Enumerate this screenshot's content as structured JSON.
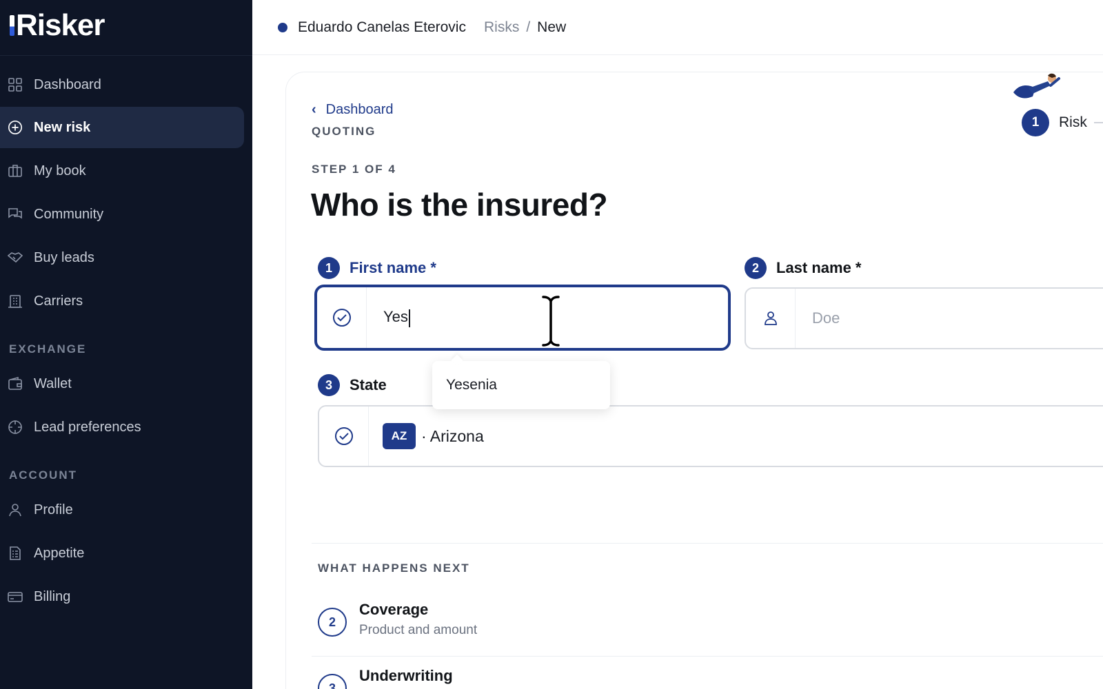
{
  "app": {
    "logo": "Risker"
  },
  "sidebar": {
    "items": [
      {
        "label": "Dashboard",
        "icon": "grid-icon"
      },
      {
        "label": "New risk",
        "icon": "plus-circle-icon",
        "active": true
      },
      {
        "label": "My book",
        "icon": "briefcase-icon"
      },
      {
        "label": "Community",
        "icon": "chat-icon"
      },
      {
        "label": "Buy leads",
        "icon": "handshake-icon"
      },
      {
        "label": "Carriers",
        "icon": "building-icon"
      }
    ],
    "exchange_title": "EXCHANGE",
    "exchange_items": [
      {
        "label": "Wallet",
        "icon": "wallet-icon"
      },
      {
        "label": "Lead preferences",
        "icon": "target-icon"
      }
    ],
    "account_title": "ACCOUNT",
    "account_items": [
      {
        "label": "Profile",
        "icon": "user-icon"
      },
      {
        "label": "Appetite",
        "icon": "document-icon"
      },
      {
        "label": "Billing",
        "icon": "card-icon"
      }
    ]
  },
  "header": {
    "user": "Eduardo Canelas Eterovic",
    "breadcrumb_parent": "Risks",
    "breadcrumb_sep": "/",
    "breadcrumb_current": "New"
  },
  "form": {
    "back_label": "Dashboard",
    "section": "QUOTING",
    "step": "STEP 1 OF 4",
    "title": "Who is the insured?",
    "first_name": {
      "num": "1",
      "label": "First name *",
      "value": "Yes"
    },
    "last_name": {
      "num": "2",
      "label": "Last name *",
      "placeholder": "Doe"
    },
    "state": {
      "num": "3",
      "label": "State",
      "code": "AZ",
      "value": "· Arizona"
    },
    "suggestion": "Yesenia"
  },
  "stepper": {
    "num": "1",
    "label": "Risk"
  },
  "next": {
    "title": "WHAT HAPPENS NEXT",
    "items": [
      {
        "num": "2",
        "title": "Coverage",
        "subtitle": "Product and amount"
      },
      {
        "num": "3",
        "title": "Underwriting",
        "subtitle": ""
      }
    ]
  },
  "colors": {
    "sidebar_bg": "#0e1526",
    "accent": "#1f3a8a"
  }
}
